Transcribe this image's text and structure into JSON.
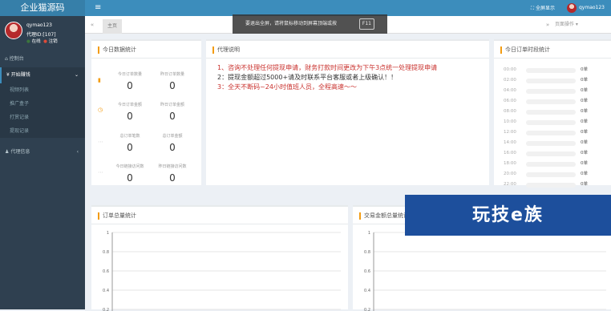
{
  "sidebar": {
    "logo": "企业猫源码",
    "username": "qymao123",
    "agent_id": "代理ID:[107]",
    "online": "在线",
    "logout": "注销",
    "items": [
      {
        "label": "控制台"
      },
      {
        "label": "开始赚钱"
      },
      {
        "label": "代理信息"
      }
    ],
    "sub_items": [
      "视频列表",
      "推广盒子",
      "打赏记录",
      "提现记录"
    ]
  },
  "topbar": {
    "fullscreen": "全屏显示",
    "username": "qymao123"
  },
  "tabs": {
    "home": "主页",
    "ops": "页面操作 ▾"
  },
  "toast": {
    "text": "要退出全屏，请将鼠标移动到屏幕顶端或按",
    "key": "F11"
  },
  "today": {
    "title": "今日数据统计",
    "stats": [
      {
        "label": "今日订单数量",
        "value": "0"
      },
      {
        "label": "昨日订单数量",
        "value": "0"
      },
      {
        "label": "今日订单金额",
        "value": "0"
      },
      {
        "label": "昨日订单金额",
        "value": "0"
      },
      {
        "label": "总订单笔数",
        "value": "0"
      },
      {
        "label": "总订单金额",
        "value": "0"
      },
      {
        "label": "今日链接访问数",
        "value": "0"
      },
      {
        "label": "昨日链接访问数",
        "value": "0"
      }
    ]
  },
  "notice": {
    "title": "代理说明",
    "lines": [
      "1、咨询不处理任何提现申请，财务打款时间更改为下午3点统一处理提现申请",
      "2：提现金额超过5000+请及时联系平台客服或者上级确认！！",
      "3：全天不断码~24小时值班人员，全程高速～～"
    ],
    "colors": [
      "#c9302c",
      "#333333",
      "#c9302c"
    ]
  },
  "hourly": {
    "title": "今日订单时段统计",
    "rows": [
      {
        "time": "00:00",
        "count": "0单"
      },
      {
        "time": "02:00",
        "count": "0单"
      },
      {
        "time": "04:00",
        "count": "0单"
      },
      {
        "time": "06:00",
        "count": "0单"
      },
      {
        "time": "08:00",
        "count": "0单"
      },
      {
        "time": "10:00",
        "count": "0单"
      },
      {
        "time": "12:00",
        "count": "0单"
      },
      {
        "time": "14:00",
        "count": "0单"
      },
      {
        "time": "16:00",
        "count": "0单"
      },
      {
        "time": "18:00",
        "count": "0单"
      },
      {
        "time": "20:00",
        "count": "0单"
      },
      {
        "time": "22:00",
        "count": "0单"
      }
    ]
  },
  "order_chart": {
    "title": "订单总量统计"
  },
  "amount_chart": {
    "title": "交易金额总量统计"
  },
  "watermark": "玩技e族",
  "chart_data": [
    {
      "type": "line",
      "title": "订单总量统计",
      "yticks": [
        "1",
        "0.8",
        "0.6",
        "0.4",
        "0.2"
      ],
      "ylim": [
        0,
        1
      ]
    },
    {
      "type": "line",
      "title": "交易金额总量统计",
      "yticks": [
        "1",
        "0.8",
        "0.6",
        "0.4",
        "0.2"
      ],
      "ylim": [
        0,
        1
      ]
    }
  ]
}
